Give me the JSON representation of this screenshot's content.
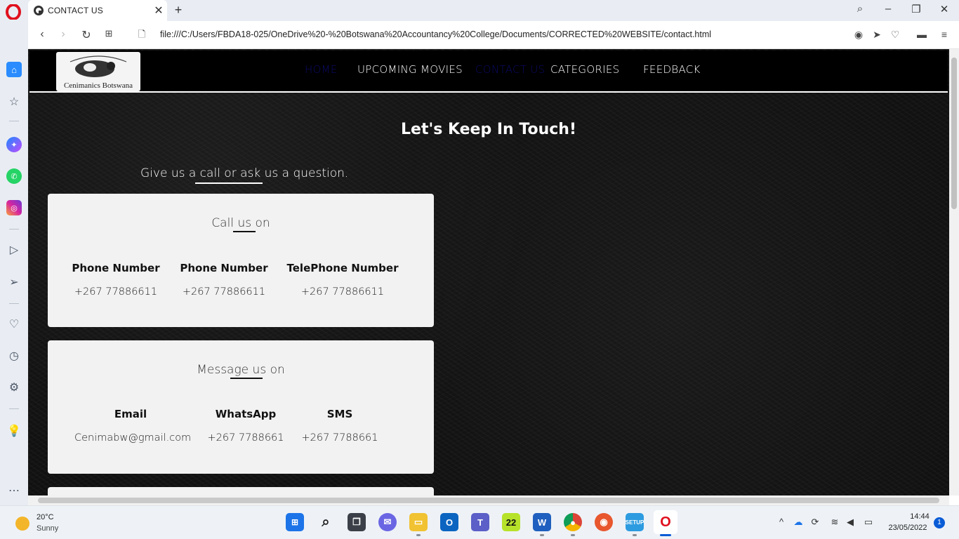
{
  "browser": {
    "tab_title": "CONTACT US",
    "url": "file:///C:/Users/FBDA18-025/OneDrive%20-%20Botswana%20Accountancy%20College/Documents/CORRECTED%20WEBSITE/contact.html"
  },
  "site": {
    "logo_text": "Cenimanics Botswana",
    "nav": [
      "HOME",
      "UPCOMING MOVIES",
      "CONTACT US",
      "CATEGORIES",
      "FEEDBACK"
    ],
    "heading": "Let's Keep In Touch!",
    "subtext": "Give us a call or ask us a question.",
    "call_card": {
      "title": "Call us on",
      "columns": [
        {
          "head": "Phone Number",
          "value": "+267 77886611"
        },
        {
          "head": "Phone Number",
          "value": "+267 77886611"
        },
        {
          "head": "TelePhone Number",
          "value": "+267 77886611"
        }
      ]
    },
    "message_card": {
      "title": "Message us on",
      "columns": [
        {
          "head": "Email",
          "value": "Cenimabw@gmail.com"
        },
        {
          "head": "WhatsApp",
          "value": "+267 7788661"
        },
        {
          "head": "SMS",
          "value": "+267 7788661"
        }
      ]
    }
  },
  "taskbar": {
    "weather_temp": "20°C",
    "weather_desc": "Sunny",
    "calendar_app": "22",
    "time": "14:44",
    "date": "23/05/2022",
    "notifications": "1"
  }
}
